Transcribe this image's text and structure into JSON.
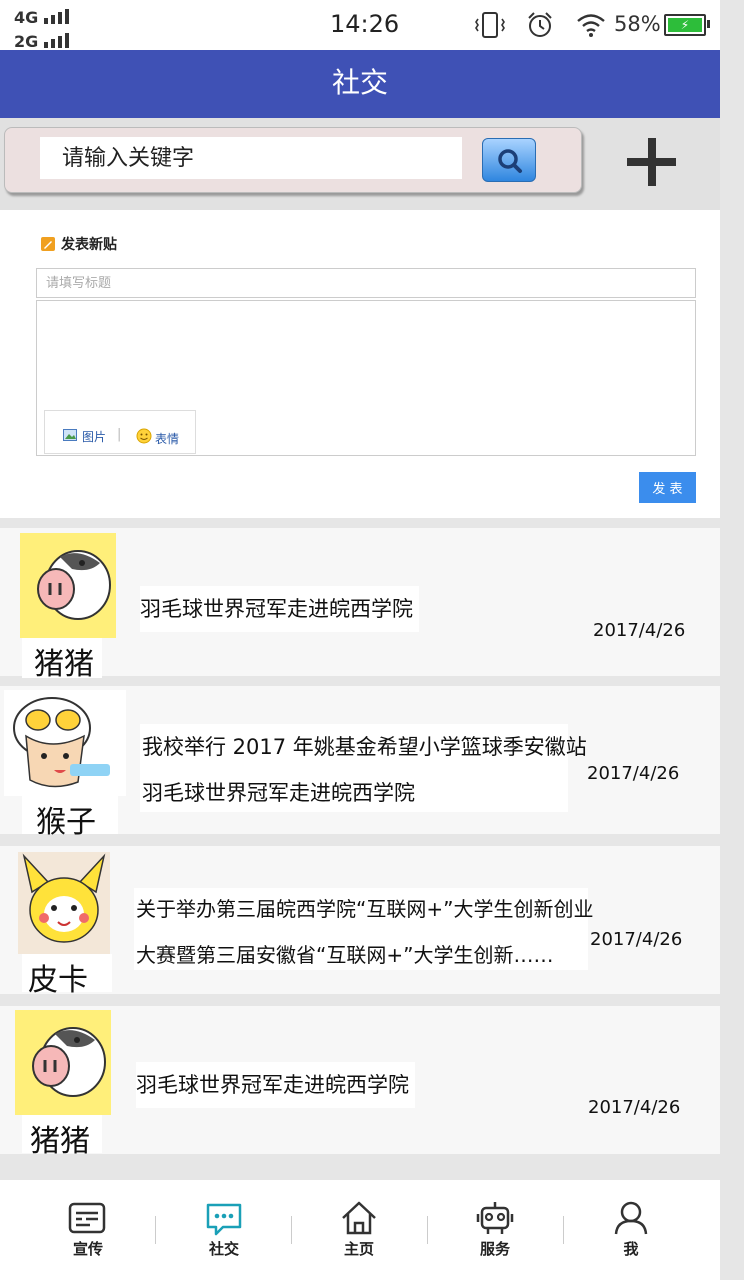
{
  "status_bar": {
    "signal_top": "4G",
    "signal_bottom": "2G",
    "time": "14:26",
    "battery": "58%"
  },
  "header": {
    "title": "社交"
  },
  "search": {
    "placeholder": "请输入关键字",
    "button_icon": "search-icon",
    "add_icon": "plus-icon"
  },
  "composer": {
    "heading": "发表新贴",
    "title_placeholder": "请填写标题",
    "tool_image": "图片",
    "tool_emoji": "表情",
    "submit": "发 表"
  },
  "feed": [
    {
      "user": "猪猪",
      "avatar_icon": "pig-cartoon-avatar",
      "lines": [
        "羽毛球世界冠军走进皖西学院"
      ],
      "date": "2017/4/26"
    },
    {
      "user": "猴子",
      "avatar_icon": "boy-cartoon-avatar",
      "lines": [
        "我校举行 2017 年姚基金希望小学篮球季安徽站",
        "羽毛球世界冠军走进皖西学院"
      ],
      "date": "2017/4/26"
    },
    {
      "user": "皮卡丘",
      "avatar_icon": "pikachu-cartoon-avatar",
      "lines": [
        "关于举办第三届皖西学院“互联网+”大学生创新创业",
        "大赛暨第三届安徽省“互联网+”大学生创新……"
      ],
      "date": "2017/4/26"
    },
    {
      "user": "猪猪",
      "avatar_icon": "pig-cartoon-avatar",
      "lines": [
        "羽毛球世界冠军走进皖西学院"
      ],
      "date": "2017/4/26"
    }
  ],
  "bottom_nav": [
    {
      "label": "宣传",
      "icon": "news-icon"
    },
    {
      "label": "社交",
      "icon": "chat-icon"
    },
    {
      "label": "主页",
      "icon": "home-icon"
    },
    {
      "label": "服务",
      "icon": "robot-icon"
    },
    {
      "label": "我",
      "icon": "person-icon"
    }
  ],
  "colors": {
    "header": "#3f51b5",
    "active_nav": "#1aa0b7",
    "publish": "#3b8ded"
  }
}
